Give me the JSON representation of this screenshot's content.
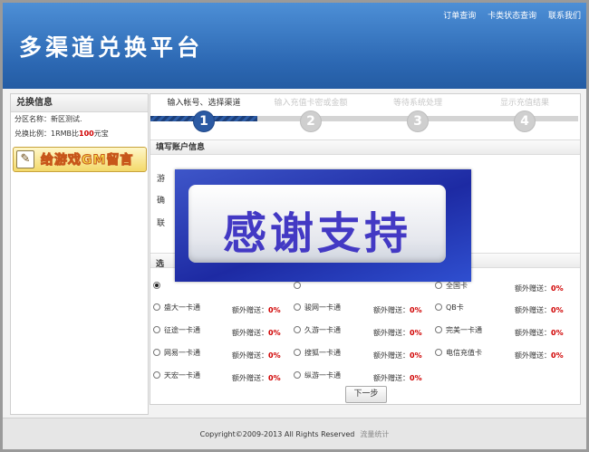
{
  "header": {
    "title": "多渠道兑换平台",
    "links": [
      "订单查询",
      "卡类状态查询",
      "联系我们"
    ]
  },
  "sidebar": {
    "heading": "兑换信息",
    "zone_label": "分区名称：",
    "zone_value": "新区测试.",
    "ratio_prefix": "兑换比例：1RMB比",
    "ratio_value": "100",
    "ratio_suffix": "元宝",
    "gm_button": "给游戏GM留言"
  },
  "steps": [
    {
      "num": "1",
      "label": "输入帐号、选择渠道",
      "active": true
    },
    {
      "num": "2",
      "label": "输入充值卡密或金额",
      "active": false
    },
    {
      "num": "3",
      "label": "等待系统处理",
      "active": false
    },
    {
      "num": "4",
      "label": "显示充值结果",
      "active": false
    }
  ],
  "form": {
    "section_title": "填写账户信息",
    "partial_label_1": "游",
    "partial_label_2": "确",
    "partial_label_3": "联",
    "channel_section_partial": "选"
  },
  "channels": {
    "bonus_label": "额外赠送：",
    "items": [
      {
        "name": "",
        "bonus": "",
        "selected": true
      },
      {
        "name": "",
        "bonus": "",
        "selected": false
      },
      {
        "name": "全国卡",
        "bonus": "0%",
        "selected": false
      },
      {
        "name": "盛大一卡通",
        "bonus": "0%",
        "selected": false
      },
      {
        "name": "骏网一卡通",
        "bonus": "0%",
        "selected": false
      },
      {
        "name": "QB卡",
        "bonus": "0%",
        "selected": false
      },
      {
        "name": "征途一卡通",
        "bonus": "0%",
        "selected": false
      },
      {
        "name": "久游一卡通",
        "bonus": "0%",
        "selected": false
      },
      {
        "name": "完美一卡通",
        "bonus": "0%",
        "selected": false
      },
      {
        "name": "网易一卡通",
        "bonus": "0%",
        "selected": false
      },
      {
        "name": "搜狐一卡通",
        "bonus": "0%",
        "selected": false
      },
      {
        "name": "电信充值卡",
        "bonus": "0%",
        "selected": false
      },
      {
        "name": "天宏一卡通",
        "bonus": "0%",
        "selected": false
      },
      {
        "name": "纵游一卡通",
        "bonus": "0%",
        "selected": false
      }
    ]
  },
  "next_button": "下一步",
  "overlay_text": "感谢支持",
  "footer": {
    "copyright": "Copyright©2009-2013 All Rights Reserved",
    "stats_link": "流量统计"
  },
  "colors": {
    "header_blue": "#2c68b3",
    "active_step": "#2b5aa3",
    "highlight_red": "#d00000",
    "overlay_text": "#4339c4"
  }
}
